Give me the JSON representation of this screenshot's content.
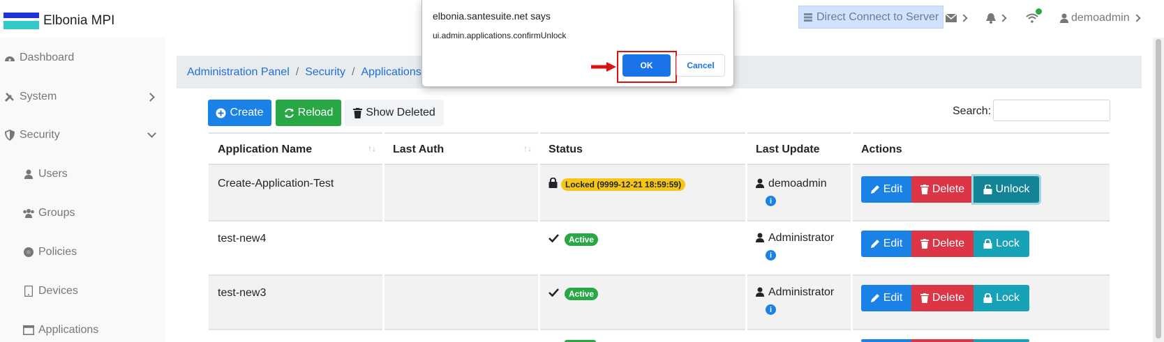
{
  "app": {
    "title": "Elbonia MPI"
  },
  "topbar": {
    "direct_connect": "Direct Connect to Server",
    "user": "demoadmin"
  },
  "sidebar": {
    "items": [
      {
        "label": "Dashboard",
        "icon": "dashboard-icon"
      },
      {
        "label": "System",
        "icon": "tools-icon"
      },
      {
        "label": "Security",
        "icon": "shield-icon"
      },
      {
        "label": "Users",
        "icon": "user-icon"
      },
      {
        "label": "Groups",
        "icon": "users-icon"
      },
      {
        "label": "Policies",
        "icon": "certificate-icon"
      },
      {
        "label": "Devices",
        "icon": "tablet-icon"
      },
      {
        "label": "Applications",
        "icon": "window-icon"
      }
    ]
  },
  "breadcrumb": [
    "Administration Panel",
    "Security",
    "Applications"
  ],
  "toolbar": {
    "create": "Create",
    "reload": "Reload",
    "show_deleted": "Show Deleted"
  },
  "search": {
    "label": "Search:",
    "value": ""
  },
  "table": {
    "headers": [
      "Application Name",
      "Last Auth",
      "Status",
      "Last Update",
      "Actions"
    ],
    "rows": [
      {
        "name": "Create-Application-Test",
        "last_auth": "",
        "status": "Locked (9999-12-21 18:59:59)",
        "updated_by": "demoadmin",
        "lock_action": "Unlock"
      },
      {
        "name": "test-new4",
        "last_auth": "",
        "status": "Active",
        "updated_by": "Administrator",
        "lock_action": "Lock"
      },
      {
        "name": "test-new3",
        "last_auth": "",
        "status": "Active",
        "updated_by": "Administrator",
        "lock_action": "Lock"
      }
    ],
    "edit_label": "Edit",
    "delete_label": "Delete"
  },
  "dialog": {
    "title": "elbonia.santesuite.net says",
    "message": "ui.admin.applications.confirmUnlock",
    "ok": "OK",
    "cancel": "Cancel"
  },
  "colors": {
    "primary": "#1a82e6",
    "success": "#28a745",
    "danger": "#dc3545",
    "info": "#17a2b8",
    "warning": "#f5c518",
    "highlight": "#e01010"
  }
}
